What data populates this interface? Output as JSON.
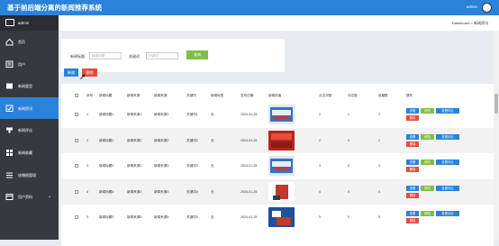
{
  "app": {
    "title": "基于前后端分离的新闻推荐系统",
    "user": "admin"
  },
  "sidebar": {
    "header": "admin",
    "items": [
      {
        "label": "首页",
        "icon": "home-icon",
        "active": false,
        "chevron": false
      },
      {
        "label": "用户",
        "icon": "user-icon",
        "active": false,
        "chevron": false
      },
      {
        "label": "新闻类型",
        "icon": "list-icon",
        "active": false,
        "chevron": false
      },
      {
        "label": "新闻资讯",
        "icon": "news-icon",
        "active": true,
        "chevron": false
      },
      {
        "label": "新闻评论",
        "icon": "comment-icon",
        "active": false,
        "chevron": false
      },
      {
        "label": "新闻收藏",
        "icon": "grid-icon",
        "active": false,
        "chevron": false
      },
      {
        "label": "轮播图管理",
        "icon": "menu-icon",
        "active": false,
        "chevron": false
      },
      {
        "label": "用户资料",
        "icon": "profile-icon",
        "active": false,
        "chevron": true
      }
    ],
    "chevron_glyph": "⌄"
  },
  "breadcrumb": "Dashboard > 新闻资讯",
  "search": {
    "title_label": "新闻标题",
    "title_placeholder": "新闻标题",
    "keyword_label": "关键词",
    "keyword_placeholder": "关键词",
    "query_button": "查询"
  },
  "toolbar": {
    "add": "新增",
    "delete": "删除"
  },
  "table": {
    "headers": [
      "序号",
      "新闻标题",
      "新闻来源",
      "新闻来源",
      "关键词",
      "新闻标签",
      "发布日期",
      "新闻封面",
      "点击次数",
      "评论数",
      "收藏数",
      "操作"
    ],
    "actions": {
      "view": "查看",
      "edit": "修改",
      "comments": "查看评论",
      "delete": "删除"
    },
    "rows": [
      {
        "no": "1",
        "title": "新闻标题1",
        "source": "新闻来源1",
        "source2": "新闻来源1",
        "keyword": "关键词1",
        "tag": "无",
        "date": "2024-01-25",
        "clicks": "2",
        "comments": "1",
        "favorites": "2"
      },
      {
        "no": "2",
        "title": "新闻标题2",
        "source": "新闻来源2",
        "source2": "新闻来源2",
        "keyword": "关键词2",
        "tag": "无",
        "date": "2024-01-25",
        "clicks": "2",
        "comments": "0",
        "favorites": "2"
      },
      {
        "no": "3",
        "title": "新闻标题3",
        "source": "新闻来源3",
        "source2": "新闻来源3",
        "keyword": "关键词3",
        "tag": "无",
        "date": "2024-01-25",
        "clicks": "3",
        "comments": "0",
        "favorites": "3"
      },
      {
        "no": "4",
        "title": "新闻标题4",
        "source": "新闻来源4",
        "source2": "新闻来源4",
        "keyword": "关键词4",
        "tag": "无",
        "date": "2024-01-25",
        "clicks": "4",
        "comments": "0",
        "favorites": "4"
      },
      {
        "no": "5",
        "title": "新闻标题5",
        "source": "新闻来源5",
        "source2": "新闻来源5",
        "keyword": "关键词5",
        "tag": "无",
        "date": "2024-01-25",
        "clicks": "5",
        "comments": "0",
        "favorites": "5"
      }
    ]
  },
  "colors": {
    "primary": "#2b82d9",
    "success": "#7ebf44",
    "danger": "#e34d40",
    "sidebar": "#363a3f"
  }
}
